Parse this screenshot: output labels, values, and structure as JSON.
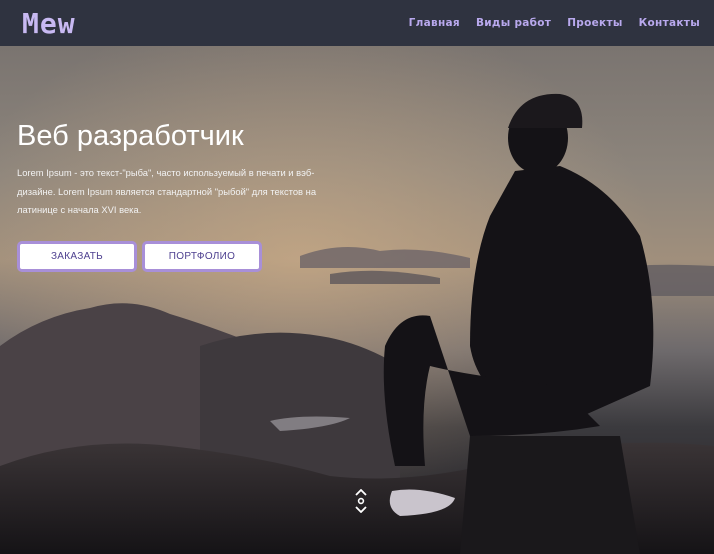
{
  "header": {
    "logo": "Mew",
    "nav": [
      {
        "label": "Главная"
      },
      {
        "label": "Виды работ"
      },
      {
        "label": "Проекты"
      },
      {
        "label": "Контакты"
      }
    ]
  },
  "hero": {
    "title": "Веб разработчик",
    "text": "Lorem Ipsum - это текст-\"рыба\", часто используемый в печати и вэб-дизайне. Lorem Ipsum является стандартной \"рыбой\" для текстов на латинице с начала XVI века.",
    "order_button": "ЗАКАЗАТЬ",
    "portfolio_button": "ПОРТФОЛИО",
    "scroll_icon": "scroll-down-icon"
  },
  "colors": {
    "navbar_bg": "#2f3340",
    "accent": "#b9a9ee",
    "button_border": "#a88fd8",
    "button_text": "#4d3f8f"
  }
}
